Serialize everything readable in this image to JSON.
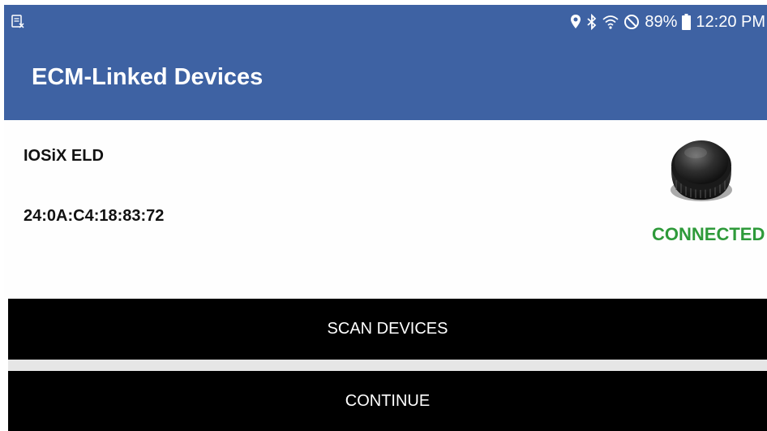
{
  "statusbar": {
    "left_icon": "screenshot-notification-icon",
    "battery": "89%",
    "time": "12:20 PM",
    "icons": [
      "location-icon",
      "bluetooth-icon",
      "wifi-icon",
      "do-not-disturb-icon",
      "battery-icon"
    ]
  },
  "appbar": {
    "title": "ECM-Linked Devices"
  },
  "device": {
    "name": "IOSiX ELD",
    "mac": "24:0A:C4:18:83:72",
    "status": "CONNECTED",
    "image": "eld-device-image"
  },
  "actions": {
    "scan_label": "SCAN DEVICES",
    "continue_label": "CONTINUE"
  },
  "colors": {
    "header": "#3e62a3",
    "connected": "#2e9a3a",
    "button": "#000000"
  }
}
